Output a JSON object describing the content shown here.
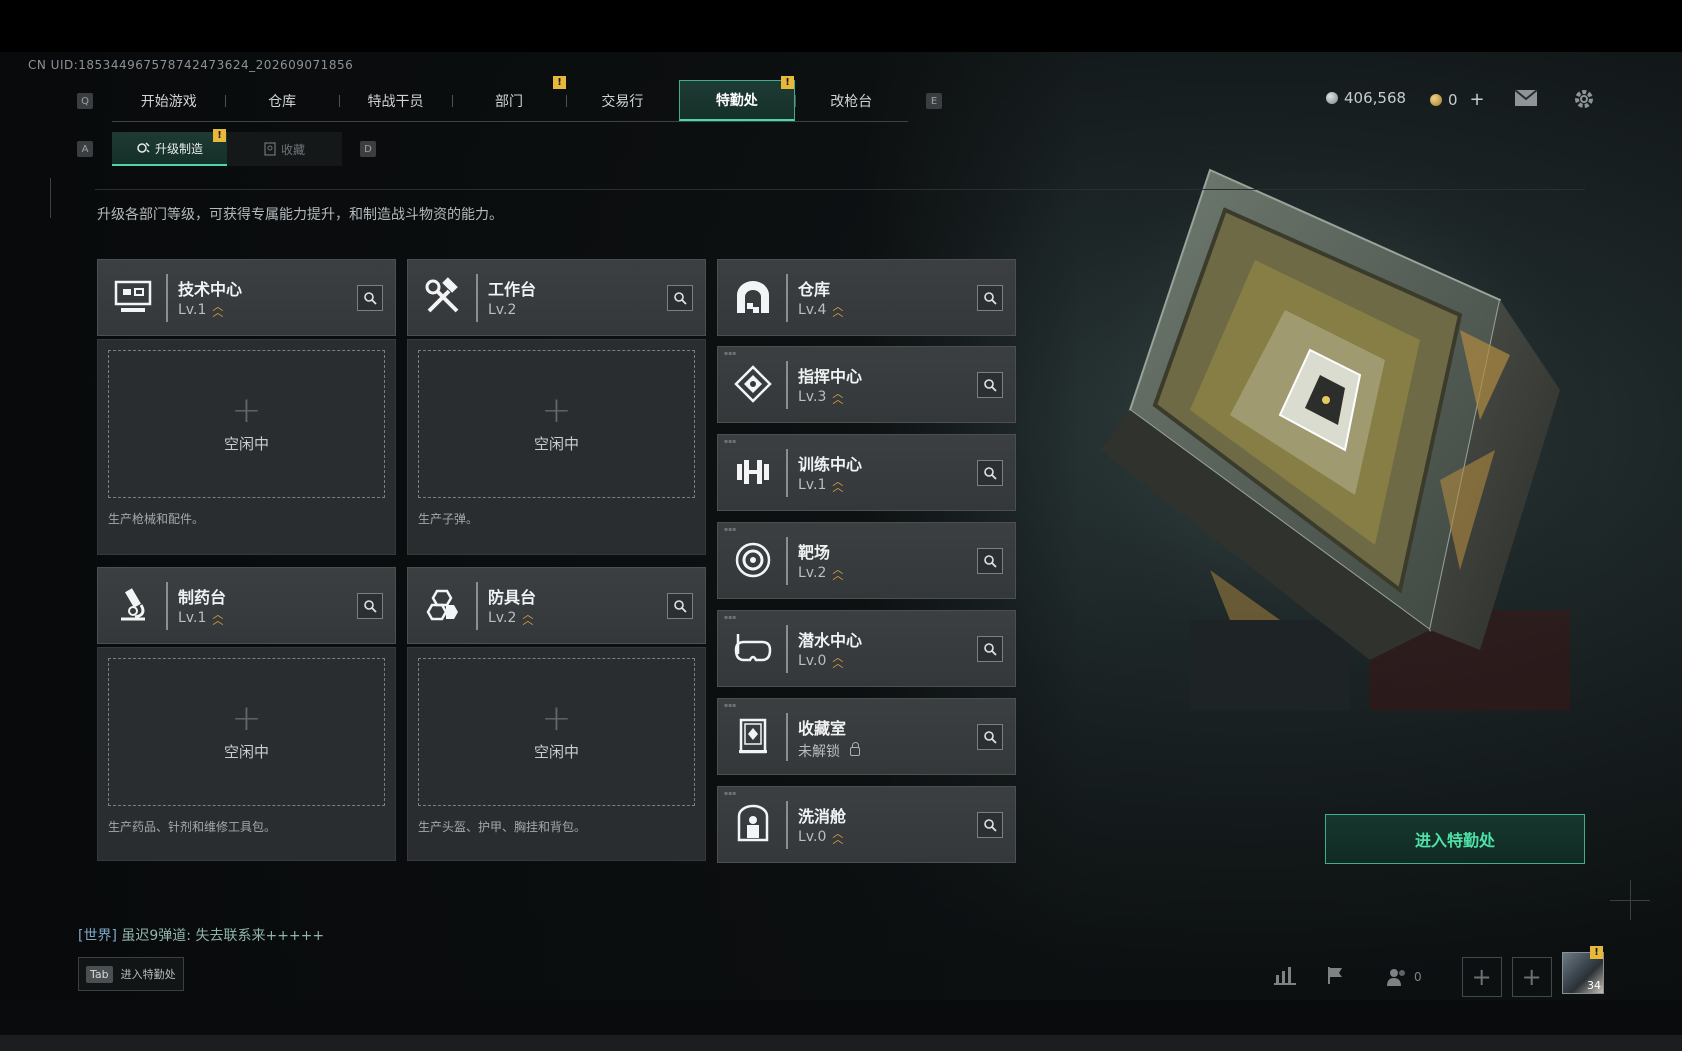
{
  "uid": "CN UID:185344967578742473624_202609071856",
  "nav": {
    "left_key": "Q",
    "right_key": "E",
    "tabs": [
      {
        "label": "开始游戏"
      },
      {
        "label": "仓库"
      },
      {
        "label": "特战干员"
      },
      {
        "label": "部门",
        "alert": "!"
      },
      {
        "label": "交易行"
      },
      {
        "label": "特勤处",
        "alert": "!",
        "active": true
      },
      {
        "label": "改枪台"
      }
    ]
  },
  "subnav": {
    "left_key": "A",
    "right_key": "D",
    "tabs": [
      {
        "label": "升级制造",
        "alert": "!",
        "active": true
      },
      {
        "label": "收藏"
      }
    ]
  },
  "currency": {
    "silver": "406,568",
    "gold": "0",
    "gold_add": "+"
  },
  "description": "升级各部门等级，可获得专属能力提升，和制造战斗物资的能力。",
  "production_cards": [
    {
      "title": "技术中心",
      "level": "Lv.1",
      "slot_text": "空闲中",
      "desc": "生产枪械和配件。",
      "plus": "+"
    },
    {
      "title": "工作台",
      "level": "Lv.2",
      "slot_text": "空闲中",
      "desc": "生产子弹。",
      "plus": "+"
    },
    {
      "title": "制药台",
      "level": "Lv.1",
      "slot_text": "空闲中",
      "desc": "生产药品、针剂和维修工具包。",
      "plus": "+"
    },
    {
      "title": "防具台",
      "level": "Lv.2",
      "slot_text": "空闲中",
      "desc": "生产头盔、护甲、胸挂和背包。",
      "plus": "+"
    }
  ],
  "facility_cards": [
    {
      "title": "仓库",
      "level": "Lv.4"
    },
    {
      "title": "指挥中心",
      "level": "Lv.3"
    },
    {
      "title": "训练中心",
      "level": "Lv.1"
    },
    {
      "title": "靶场",
      "level": "Lv.2"
    },
    {
      "title": "潜水中心",
      "level": "Lv.0"
    },
    {
      "title": "收藏室",
      "level": "未解锁",
      "locked": true
    },
    {
      "title": "洗消舱",
      "level": "Lv.0"
    }
  ],
  "enter_button": "进入特勤处",
  "chat": {
    "channel": "[世界]",
    "sender": "虽迟9弹道:",
    "message": "失去联系来+++++"
  },
  "tab_hint": {
    "key": "Tab",
    "label": "进入特勤处"
  },
  "bottom_bar": {
    "friends_count": "0",
    "plus": "+",
    "avatar_level": "34",
    "avatar_alert": "!"
  },
  "colors": {
    "accent": "#4fd6a6",
    "alert": "#e8b83a",
    "upgrade_chevron": "#e0a63d"
  }
}
